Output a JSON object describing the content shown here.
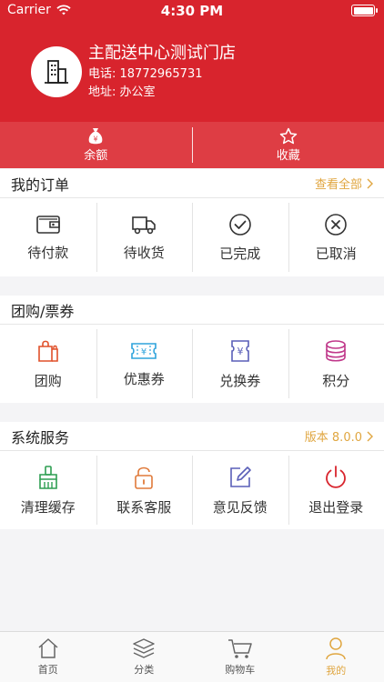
{
  "status_bar": {
    "carrier": "Carrier",
    "time": "4:30 PM"
  },
  "store": {
    "name": "主配送中心测试门店",
    "phone": "电话: 18772965731",
    "address": "地址: 办公室"
  },
  "quick": [
    {
      "label": "余额",
      "icon": "money-bag-icon"
    },
    {
      "label": "收藏",
      "icon": "star-icon"
    }
  ],
  "orders": {
    "title": "我的订单",
    "link": "查看全部",
    "items": [
      {
        "label": "待付款",
        "icon": "wallet-icon"
      },
      {
        "label": "待收货",
        "icon": "truck-icon"
      },
      {
        "label": "已完成",
        "icon": "check-circle-icon"
      },
      {
        "label": "已取消",
        "icon": "x-circle-icon"
      }
    ]
  },
  "group": {
    "title": "团购/票券",
    "items": [
      {
        "label": "团购",
        "icon": "shopping-bag-icon"
      },
      {
        "label": "优惠券",
        "icon": "coupon-icon"
      },
      {
        "label": "兑换券",
        "icon": "voucher-icon"
      },
      {
        "label": "积分",
        "icon": "coins-icon"
      }
    ]
  },
  "system": {
    "title": "系统服务",
    "link": "版本 8.0.0",
    "items": [
      {
        "label": "清理缓存",
        "icon": "broom-icon"
      },
      {
        "label": "联系客服",
        "icon": "lock-icon"
      },
      {
        "label": "意见反馈",
        "icon": "edit-icon"
      },
      {
        "label": "退出登录",
        "icon": "power-icon"
      }
    ]
  },
  "tabbar": [
    {
      "label": "首页",
      "icon": "home-icon"
    },
    {
      "label": "分类",
      "icon": "layers-icon"
    },
    {
      "label": "购物车",
      "icon": "cart-icon"
    },
    {
      "label": "我的",
      "icon": "person-icon",
      "active": true
    }
  ],
  "colors": {
    "brand": "#d8242d",
    "accent": "#e0a640"
  }
}
